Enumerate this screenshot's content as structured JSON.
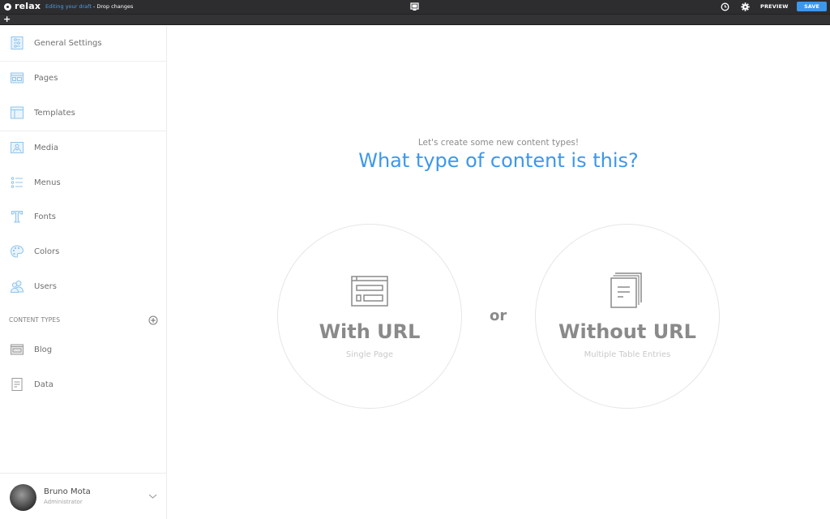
{
  "topbar": {
    "logo_text": "relax",
    "draft_status": "Editing your draft",
    "draft_separator": " - ",
    "drop_changes": "Drop changes",
    "preview_label": "PREVIEW",
    "save_label": "SAVE",
    "add_label": "+",
    "icons": [
      "device-monitor-icon",
      "history-clock-icon",
      "settings-gear-icon"
    ],
    "accent": "#3d97ec"
  },
  "sidebar": {
    "items": [
      {
        "label": "General Settings",
        "icon": "general-settings-icon"
      },
      {
        "label": "Pages",
        "icon": "pages-icon"
      },
      {
        "label": "Templates",
        "icon": "templates-icon"
      },
      {
        "label": "Media",
        "icon": "media-icon"
      },
      {
        "label": "Menus",
        "icon": "menus-icon"
      },
      {
        "label": "Fonts",
        "icon": "fonts-icon"
      },
      {
        "label": "Colors",
        "icon": "colors-palette-icon"
      },
      {
        "label": "Users",
        "icon": "users-icon"
      }
    ],
    "content_types_label": "CONTENT TYPES",
    "content_types": [
      {
        "label": "Blog",
        "icon": "blog-icon"
      },
      {
        "label": "Data",
        "icon": "data-icon"
      }
    ],
    "user": {
      "name": "Bruno Mota",
      "role": "Administrator"
    }
  },
  "main": {
    "subtitle": "Let's create some new content types!",
    "title": "What type of content is this?",
    "options": [
      {
        "title": "With URL",
        "subtitle": "Single Page",
        "icon": "single-page-icon"
      },
      {
        "title": "Without URL",
        "subtitle": "Multiple Table Entries",
        "icon": "multiple-entries-icon"
      }
    ],
    "or_label": "or"
  }
}
